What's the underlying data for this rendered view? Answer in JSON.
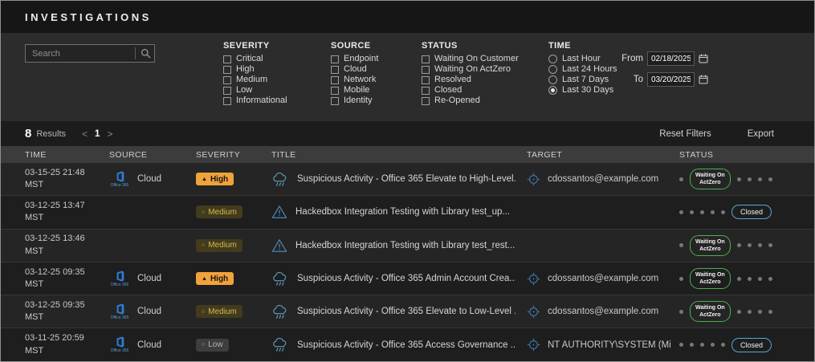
{
  "colors": {
    "high_orange": "#F0A23B",
    "medium_yellow": "#D3BA4D",
    "low_gray": "#B3B3B3",
    "waiting_green": "#4CAF50",
    "closed_blue": "#58A6D8",
    "office365_blue": "#2D7CD6",
    "title_icon_blue": "#4A86B8"
  },
  "header": {
    "title": "INVESTIGATIONS"
  },
  "filters": {
    "search_placeholder": "Search",
    "groups": {
      "severity": {
        "label": "SEVERITY",
        "options": [
          "Critical",
          "High",
          "Medium",
          "Low",
          "Informational"
        ]
      },
      "source": {
        "label": "SOURCE",
        "options": [
          "Endpoint",
          "Cloud",
          "Network",
          "Mobile",
          "Identity"
        ]
      },
      "status": {
        "label": "STATUS",
        "options": [
          "Waiting On Customer",
          "Waiting On ActZero",
          "Resolved",
          "Closed",
          "Re-Opened"
        ]
      },
      "time": {
        "label": "TIME",
        "options": [
          "Last Hour",
          "Last 24 Hours",
          "Last 7 Days",
          "Last 30 Days"
        ],
        "selected": "Last 30 Days"
      }
    },
    "date_range": {
      "from_label": "From",
      "from_value": "02/18/2025",
      "to_label": "To",
      "to_value": "03/20/2025"
    }
  },
  "results_bar": {
    "count": "8",
    "results_label": "Results",
    "prev_label": "<",
    "page": "1",
    "next_label": ">",
    "reset_filters_label": "Reset Filters",
    "export_label": "Export"
  },
  "table": {
    "columns": [
      "TIME",
      "SOURCE",
      "SEVERITY",
      "TITLE",
      "TARGET",
      "STATUS"
    ],
    "status_slots": 6,
    "office365_caption": "Office 365",
    "rows": [
      {
        "time": "03-15-25 21:48 MST",
        "source": "Cloud",
        "source_icon": "office-365",
        "severity": "High",
        "severity_level": "high",
        "title_icon": "storm-cloud",
        "title": "Suspicious Activity - Office 365 Elevate to High-Level...",
        "target": "cdossantos@example.com",
        "status": {
          "label": "Waiting On ActZero",
          "lines": [
            "Waiting On",
            "ActZero"
          ],
          "slot": 2,
          "style": "waiting"
        }
      },
      {
        "time": "03-12-25 13:47 MST",
        "source": "",
        "source_icon": "",
        "severity": "Medium",
        "severity_level": "medium",
        "title_icon": "alert-triangle",
        "title": "Hackedbox Integration Testing with Library test_up...",
        "target": "",
        "status": {
          "label": "Closed",
          "lines": [
            "Closed"
          ],
          "slot": 6,
          "style": "closed"
        }
      },
      {
        "time": "03-12-25 13:46 MST",
        "source": "",
        "source_icon": "",
        "severity": "Medium",
        "severity_level": "medium",
        "title_icon": "alert-triangle",
        "title": "Hackedbox Integration Testing with Library test_rest...",
        "target": "",
        "status": {
          "label": "Waiting On ActZero",
          "lines": [
            "Waiting On",
            "ActZero"
          ],
          "slot": 2,
          "style": "waiting"
        }
      },
      {
        "time": "03-12-25 09:35 MST",
        "source": "Cloud",
        "source_icon": "office-365",
        "severity": "High",
        "severity_level": "high",
        "title_icon": "storm-cloud",
        "title": "Suspicious Activity - Office 365 Admin Account Crea...",
        "target": "cdossantos@example.com",
        "status": {
          "label": "Waiting On ActZero",
          "lines": [
            "Waiting On",
            "ActZero"
          ],
          "slot": 2,
          "style": "waiting"
        }
      },
      {
        "time": "03-12-25 09:35 MST",
        "source": "Cloud",
        "source_icon": "office-365",
        "severity": "Medium",
        "severity_level": "medium",
        "title_icon": "storm-cloud",
        "title": "Suspicious Activity - Office 365 Elevate to Low-Level ...",
        "target": "cdossantos@example.com",
        "status": {
          "label": "Waiting On ActZero",
          "lines": [
            "Waiting On",
            "ActZero"
          ],
          "slot": 2,
          "style": "waiting"
        }
      },
      {
        "time": "03-11-25 20:59 MST",
        "source": "Cloud",
        "source_icon": "office-365",
        "severity": "Low",
        "severity_level": "low",
        "title_icon": "storm-cloud",
        "title": "Suspicious Activity - Office 365 Access Governance ...",
        "target": "NT AUTHORITY\\SYSTEM (Micr...",
        "status": {
          "label": "Closed",
          "lines": [
            "Closed"
          ],
          "slot": 6,
          "style": "closed"
        }
      }
    ]
  }
}
